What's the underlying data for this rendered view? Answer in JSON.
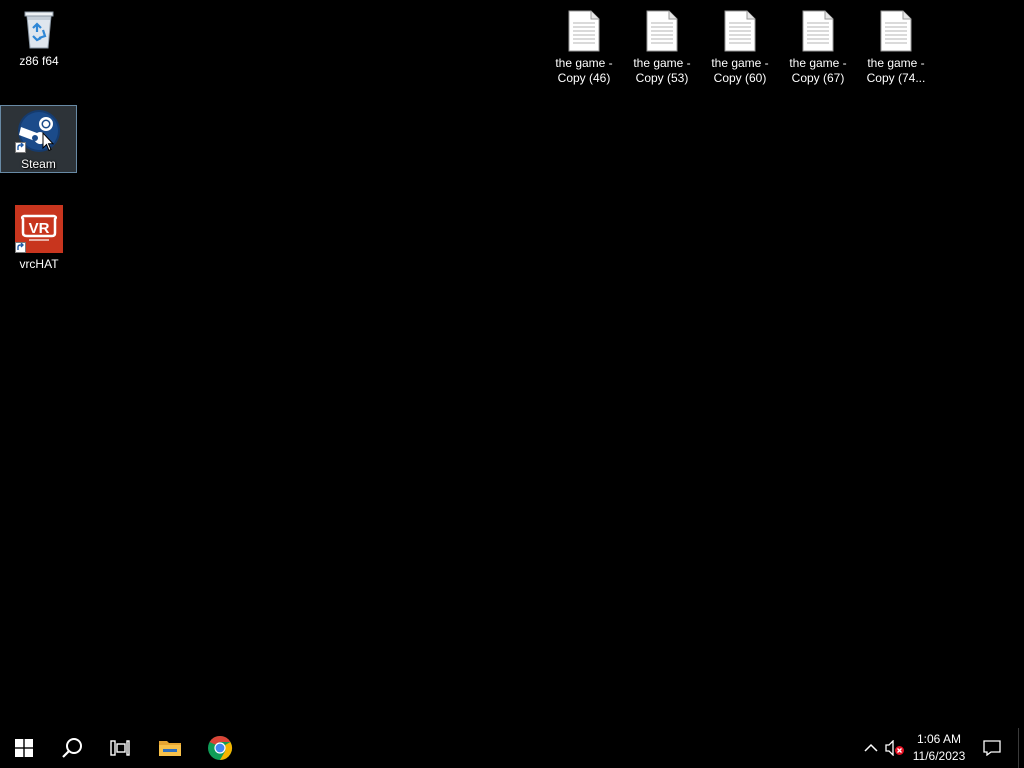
{
  "desktop": {
    "icons": [
      {
        "label": "z86 f64",
        "icon": "recycle-bin-icon"
      },
      {
        "label": "Steam",
        "icon": "steam-icon",
        "selected": true
      },
      {
        "label": "vrcHAT",
        "icon": "vrchat-icon"
      }
    ],
    "files": [
      {
        "label": "the game -\nCopy (46)",
        "icon": "text-file-icon"
      },
      {
        "label": "the game -\nCopy (53)",
        "icon": "text-file-icon"
      },
      {
        "label": "the game -\nCopy (60)",
        "icon": "text-file-icon"
      },
      {
        "label": "the game -\nCopy (67)",
        "icon": "text-file-icon"
      },
      {
        "label": "the game -\nCopy (74...",
        "icon": "text-file-icon"
      }
    ],
    "vrchat_logo_text": "VR"
  },
  "taskbar": {
    "buttons": [
      {
        "name": "start-button",
        "icon": "windows-logo-icon"
      },
      {
        "name": "search-button",
        "icon": "search-icon"
      },
      {
        "name": "task-view-button",
        "icon": "task-view-icon"
      },
      {
        "name": "file-explorer-button",
        "icon": "folder-icon"
      },
      {
        "name": "chrome-button",
        "icon": "chrome-icon"
      }
    ],
    "tray": {
      "overflow_icon": "chevron-up-icon",
      "volume_icon": "volume-muted-icon",
      "notification_icon": "action-center-icon"
    },
    "clock": {
      "time": "1:06 AM",
      "date": "11/6/2023"
    }
  },
  "colors": {
    "background": "#000000",
    "text": "#ffffff",
    "selection": "#99d1ff",
    "chrome_red": "#db4437",
    "chrome_yellow": "#f4b400",
    "chrome_green": "#0f9d58",
    "chrome_blue": "#4285f4",
    "folder": "#f8c14a",
    "vrchat_bg": "#c8351e",
    "steam_blue": "#1b4b8a",
    "muted_x": "#e81123"
  }
}
